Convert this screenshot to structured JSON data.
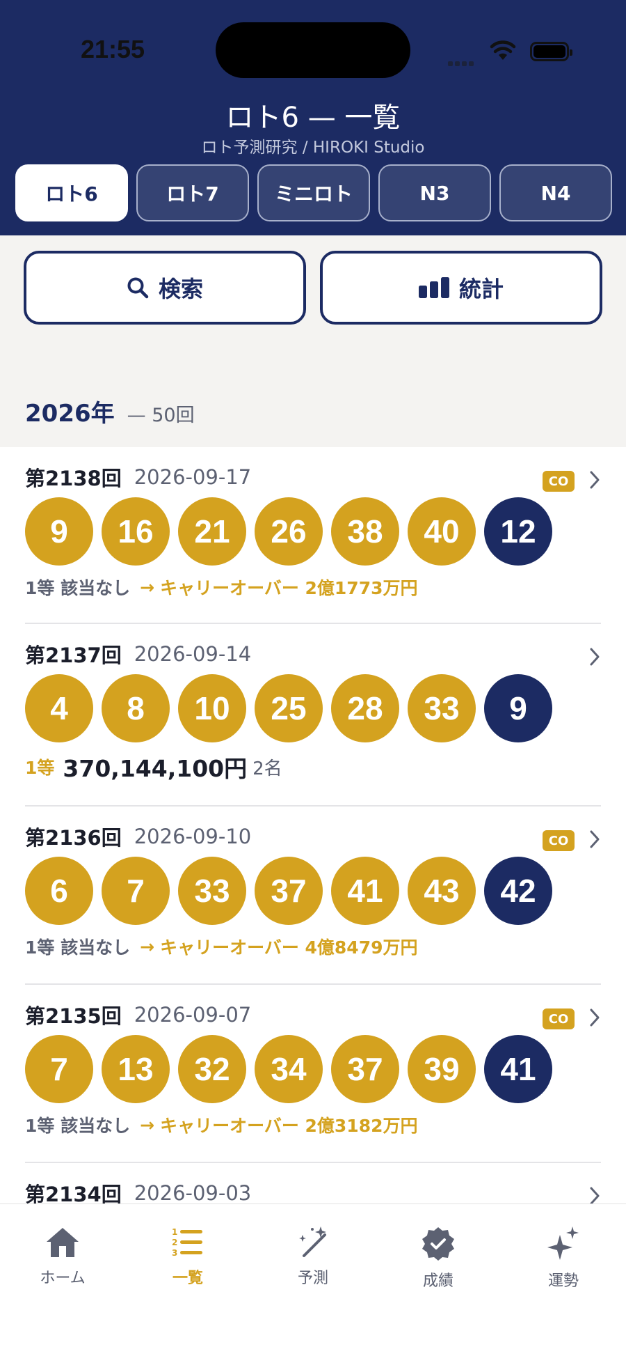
{
  "status_bar": {
    "time": "21:55"
  },
  "header": {
    "title": "ロト6 — 一覧",
    "subtitle": "ロト予測研究 / HIROKI Studio",
    "tabs": [
      {
        "label": "ロト6",
        "active": true
      },
      {
        "label": "ロト7",
        "active": false
      },
      {
        "label": "ミニロト",
        "active": false
      },
      {
        "label": "N3",
        "active": false
      },
      {
        "label": "N4",
        "active": false
      }
    ]
  },
  "actions": {
    "search_label": "検索",
    "stats_label": "統計"
  },
  "year_section": {
    "year": "2026年",
    "count": "— 50回"
  },
  "draws": [
    {
      "no": "第2138回",
      "date": "2026-09-17",
      "co_badge": "CO",
      "main": [
        "9",
        "16",
        "21",
        "26",
        "38",
        "40"
      ],
      "bonus": "12",
      "result": {
        "none": "1等 該当なし",
        "arrow": "→",
        "carryover": "キャリーオーバー 2億1773万円"
      }
    },
    {
      "no": "第2137回",
      "date": "2026-09-14",
      "main": [
        "4",
        "8",
        "10",
        "25",
        "28",
        "33"
      ],
      "bonus": "9",
      "result": {
        "rank": "1等",
        "prize": "370,144,100円",
        "winners": "2名"
      }
    },
    {
      "no": "第2136回",
      "date": "2026-09-10",
      "co_badge": "CO",
      "main": [
        "6",
        "7",
        "33",
        "37",
        "41",
        "43"
      ],
      "bonus": "42",
      "result": {
        "none": "1等 該当なし",
        "arrow": "→",
        "carryover": "キャリーオーバー 4億8479万円"
      }
    },
    {
      "no": "第2135回",
      "date": "2026-09-07",
      "co_badge": "CO",
      "main": [
        "7",
        "13",
        "32",
        "34",
        "37",
        "39"
      ],
      "bonus": "41",
      "result": {
        "none": "1等 該当なし",
        "arrow": "→",
        "carryover": "キャリーオーバー 2億3182万円"
      }
    },
    {
      "no": "第2134回",
      "date": "2026-09-03"
    }
  ],
  "bottom_nav": [
    {
      "label": "ホーム",
      "icon": "home-icon",
      "active": false
    },
    {
      "label": "一覧",
      "icon": "list-icon",
      "active": true
    },
    {
      "label": "予測",
      "icon": "magic-wand-icon",
      "active": false
    },
    {
      "label": "成績",
      "icon": "check-badge-icon",
      "active": false
    },
    {
      "label": "運勢",
      "icon": "sparkles-icon",
      "active": false
    }
  ],
  "colors": {
    "navy": "#1c2b63",
    "gold": "#d4a21f"
  }
}
